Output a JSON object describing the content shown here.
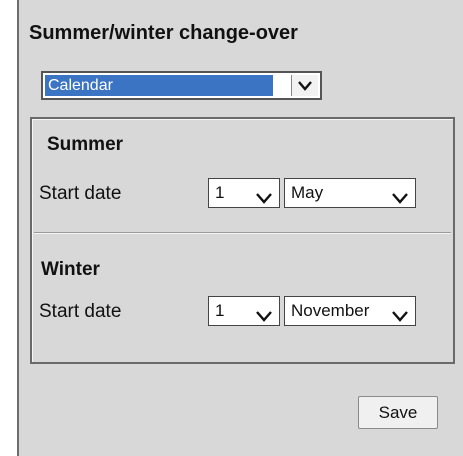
{
  "title": "Summer/winter change-over",
  "mode_select": {
    "value": "Calendar"
  },
  "summer": {
    "heading": "Summer",
    "start_label": "Start date",
    "day": "1",
    "month": "May"
  },
  "winter": {
    "heading": "Winter",
    "start_label": "Start date",
    "day": "1",
    "month": "November"
  },
  "save_label": "Save",
  "icons": [
    "chevron-down-icon"
  ],
  "colors": {
    "selection": "#3b74c3",
    "panel": "#d8d8d8"
  }
}
